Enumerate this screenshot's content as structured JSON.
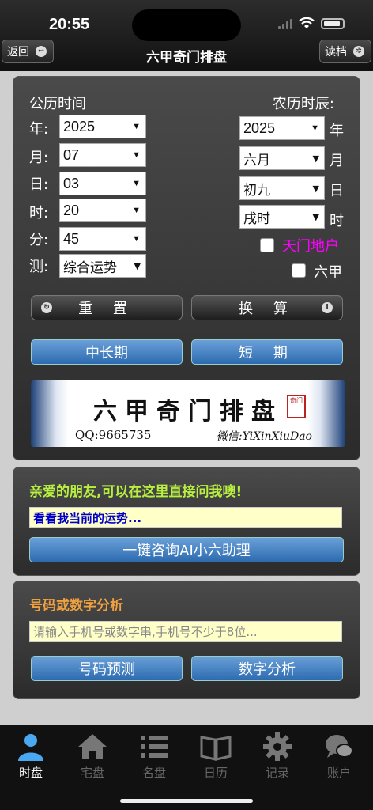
{
  "status": {
    "time": "20:55"
  },
  "nav": {
    "back_label": "返回",
    "title": "六甲奇门排盘",
    "save_label": "读档"
  },
  "form": {
    "solar_title": "公历时间",
    "lunar_title": "农历时辰:",
    "solar": [
      {
        "label": "年:",
        "value": "2025"
      },
      {
        "label": "月:",
        "value": "07"
      },
      {
        "label": "日:",
        "value": "03"
      },
      {
        "label": "时:",
        "value": "20"
      },
      {
        "label": "分:",
        "value": "45"
      },
      {
        "label": "测:",
        "value": "综合运势"
      }
    ],
    "lunar": [
      {
        "value": "2025",
        "unit": "年"
      },
      {
        "value": "六月",
        "unit": "月"
      },
      {
        "value": "初九",
        "unit": "日"
      },
      {
        "value": "戌时",
        "unit": "时"
      }
    ],
    "option_tianmen": "天门地户",
    "option_liujia": "六甲",
    "reset_label": "重 置",
    "convert_label": "换 算",
    "long_term_label": "中长期",
    "short_term_label": "短 期"
  },
  "banner": {
    "title": "六甲奇门排盘",
    "qq": "QQ:9665735",
    "wechat": "微信:YiXinXiuDao",
    "seal": "奇门"
  },
  "ai": {
    "heading": "亲爱的朋友,可以在这里直接问我噢!",
    "input_value": "看看我当前的运势...",
    "button_label": "一键咨询AI小六助理"
  },
  "number": {
    "heading": "号码或数字分析",
    "placeholder": "请输入手机号或数字串,手机号不少于8位...",
    "predict_label": "号码预测",
    "analyze_label": "数字分析"
  },
  "tabs": [
    {
      "label": "时盘",
      "icon": "person-icon"
    },
    {
      "label": "宅盘",
      "icon": "house-icon"
    },
    {
      "label": "名盘",
      "icon": "list-icon"
    },
    {
      "label": "日历",
      "icon": "book-icon"
    },
    {
      "label": "记录",
      "icon": "gear-icon"
    },
    {
      "label": "账户",
      "icon": "chat-icon"
    }
  ],
  "colors": {
    "accent_yellow": "#f5d020",
    "accent_orange": "#f0a040",
    "tianmen_magenta": "#ff00ff",
    "ai_heading_green": "#b8f040",
    "button_blue": "#3d7cc0"
  }
}
